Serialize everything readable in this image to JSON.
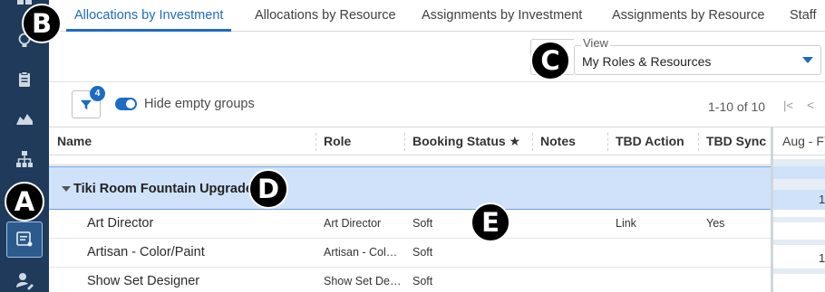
{
  "tabs": [
    {
      "label": "Allocations by Investment",
      "active": true
    },
    {
      "label": "Allocations by Resource",
      "active": false
    },
    {
      "label": "Assignments by Investment",
      "active": false
    },
    {
      "label": "Assignments by Resource",
      "active": false
    },
    {
      "label": "Staff",
      "active": false
    }
  ],
  "view": {
    "label": "View",
    "value": "My Roles & Resources"
  },
  "toolbar": {
    "filter_count": "4",
    "hide_empty_label": "Hide empty groups",
    "hide_empty_on": true,
    "pager_text": "1-10 of 10",
    "first_glyph": "|<",
    "prev_glyph": "<"
  },
  "grid": {
    "columns": [
      "Name",
      "Role",
      "Booking Status ★",
      "Notes",
      "TBD Action",
      "TBD Sync",
      "Aug - FY"
    ],
    "group": {
      "title": "Tiki Room Fountain Upgrade"
    },
    "rows": [
      {
        "name": "Art Director",
        "role": "Art Director",
        "booking": "Soft",
        "notes": "",
        "tbd_action": "Link",
        "tbd_sync": "Yes"
      },
      {
        "name": "Artisan - Color/Paint",
        "role": "Artisan - Col…",
        "booking": "Soft",
        "notes": "",
        "tbd_action": "",
        "tbd_sync": ""
      },
      {
        "name": "Show Set Designer",
        "role": "Show Set De…",
        "booking": "Soft",
        "notes": "",
        "tbd_action": "",
        "tbd_sync": ""
      }
    ],
    "timeline_values": [
      "1",
      "1"
    ]
  },
  "badges": {
    "a": "A",
    "b": "B",
    "c": "C",
    "d": "D",
    "e": "E"
  },
  "colors": {
    "accent": "#1e6bc2",
    "rail": "#1f3a5a",
    "group_row": "#cfe2fa"
  }
}
